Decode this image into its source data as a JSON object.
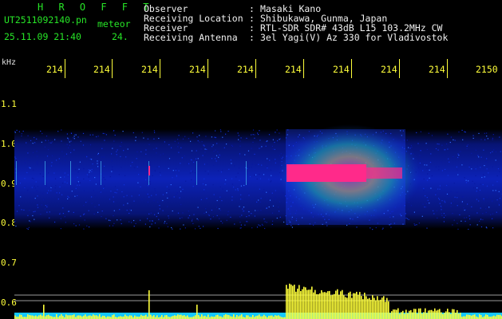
{
  "header": {
    "title": "H R O F F T",
    "file_name": "UT2511092140.pn",
    "file_type": "meteor",
    "timestamp": "25.11.09 21:40",
    "number": "24.",
    "fields": [
      {
        "label": "Observer",
        "sep": ":",
        "value": "Masaki Kano"
      },
      {
        "label": "Receiving Location",
        "sep": ":",
        "value": "Shibukawa, Gunma, Japan"
      },
      {
        "label": "Receiver",
        "sep": ":",
        "value": "RTL-SDR SDR# 43dB L15 103.2MHz CW"
      },
      {
        "label": "Receiving Antenna",
        "sep": ":",
        "value": "3el Yagi(V) Az 330 for Vladivostok"
      }
    ]
  },
  "axis": {
    "unit": "kHz",
    "time_ticks": [
      "214",
      "214",
      "214",
      "214",
      "214",
      "214",
      "214",
      "214",
      "214",
      "2150"
    ],
    "freq_ticks": [
      "1.1",
      "1.0",
      "0.9",
      "0.8",
      "0.7",
      "0.6"
    ]
  },
  "colors": {
    "text_green": "#27e527",
    "text_yellow": "#ffff3a",
    "noise_band": "#0a1aa8",
    "echo_core": "#ff2a8a",
    "echo_halo": "#23e06a",
    "amplitude": "#ffff3a",
    "baseline": "#14c8ff"
  }
}
